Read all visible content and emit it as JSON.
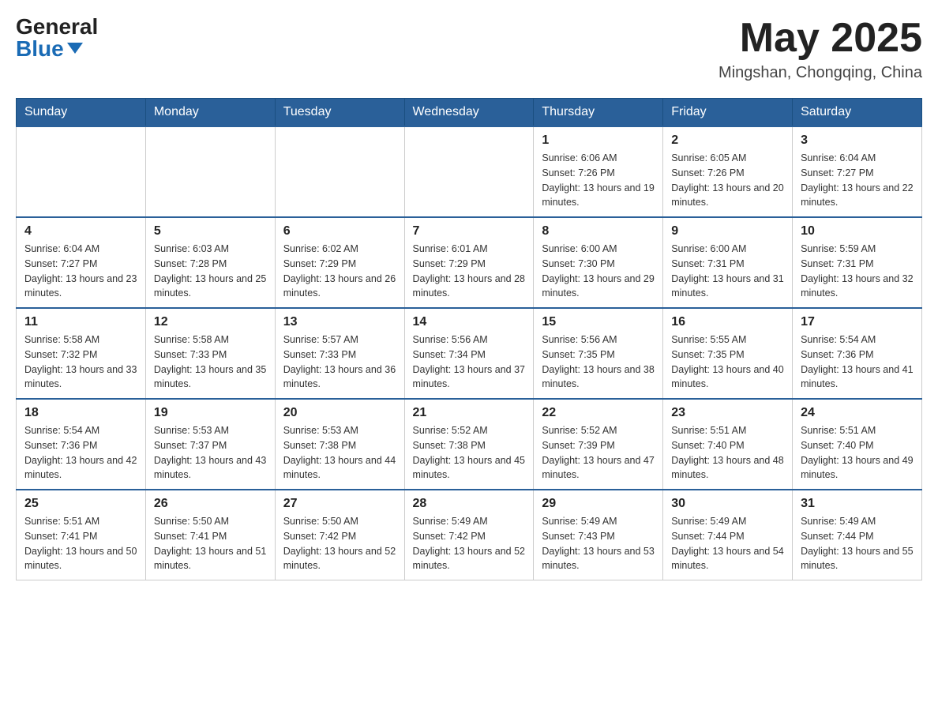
{
  "header": {
    "logo_general": "General",
    "logo_blue": "Blue",
    "month_title": "May 2025",
    "location": "Mingshan, Chongqing, China"
  },
  "days_of_week": [
    "Sunday",
    "Monday",
    "Tuesday",
    "Wednesday",
    "Thursday",
    "Friday",
    "Saturday"
  ],
  "weeks": [
    {
      "days": [
        {
          "number": "",
          "info": ""
        },
        {
          "number": "",
          "info": ""
        },
        {
          "number": "",
          "info": ""
        },
        {
          "number": "",
          "info": ""
        },
        {
          "number": "1",
          "info": "Sunrise: 6:06 AM\nSunset: 7:26 PM\nDaylight: 13 hours and 19 minutes."
        },
        {
          "number": "2",
          "info": "Sunrise: 6:05 AM\nSunset: 7:26 PM\nDaylight: 13 hours and 20 minutes."
        },
        {
          "number": "3",
          "info": "Sunrise: 6:04 AM\nSunset: 7:27 PM\nDaylight: 13 hours and 22 minutes."
        }
      ]
    },
    {
      "days": [
        {
          "number": "4",
          "info": "Sunrise: 6:04 AM\nSunset: 7:27 PM\nDaylight: 13 hours and 23 minutes."
        },
        {
          "number": "5",
          "info": "Sunrise: 6:03 AM\nSunset: 7:28 PM\nDaylight: 13 hours and 25 minutes."
        },
        {
          "number": "6",
          "info": "Sunrise: 6:02 AM\nSunset: 7:29 PM\nDaylight: 13 hours and 26 minutes."
        },
        {
          "number": "7",
          "info": "Sunrise: 6:01 AM\nSunset: 7:29 PM\nDaylight: 13 hours and 28 minutes."
        },
        {
          "number": "8",
          "info": "Sunrise: 6:00 AM\nSunset: 7:30 PM\nDaylight: 13 hours and 29 minutes."
        },
        {
          "number": "9",
          "info": "Sunrise: 6:00 AM\nSunset: 7:31 PM\nDaylight: 13 hours and 31 minutes."
        },
        {
          "number": "10",
          "info": "Sunrise: 5:59 AM\nSunset: 7:31 PM\nDaylight: 13 hours and 32 minutes."
        }
      ]
    },
    {
      "days": [
        {
          "number": "11",
          "info": "Sunrise: 5:58 AM\nSunset: 7:32 PM\nDaylight: 13 hours and 33 minutes."
        },
        {
          "number": "12",
          "info": "Sunrise: 5:58 AM\nSunset: 7:33 PM\nDaylight: 13 hours and 35 minutes."
        },
        {
          "number": "13",
          "info": "Sunrise: 5:57 AM\nSunset: 7:33 PM\nDaylight: 13 hours and 36 minutes."
        },
        {
          "number": "14",
          "info": "Sunrise: 5:56 AM\nSunset: 7:34 PM\nDaylight: 13 hours and 37 minutes."
        },
        {
          "number": "15",
          "info": "Sunrise: 5:56 AM\nSunset: 7:35 PM\nDaylight: 13 hours and 38 minutes."
        },
        {
          "number": "16",
          "info": "Sunrise: 5:55 AM\nSunset: 7:35 PM\nDaylight: 13 hours and 40 minutes."
        },
        {
          "number": "17",
          "info": "Sunrise: 5:54 AM\nSunset: 7:36 PM\nDaylight: 13 hours and 41 minutes."
        }
      ]
    },
    {
      "days": [
        {
          "number": "18",
          "info": "Sunrise: 5:54 AM\nSunset: 7:36 PM\nDaylight: 13 hours and 42 minutes."
        },
        {
          "number": "19",
          "info": "Sunrise: 5:53 AM\nSunset: 7:37 PM\nDaylight: 13 hours and 43 minutes."
        },
        {
          "number": "20",
          "info": "Sunrise: 5:53 AM\nSunset: 7:38 PM\nDaylight: 13 hours and 44 minutes."
        },
        {
          "number": "21",
          "info": "Sunrise: 5:52 AM\nSunset: 7:38 PM\nDaylight: 13 hours and 45 minutes."
        },
        {
          "number": "22",
          "info": "Sunrise: 5:52 AM\nSunset: 7:39 PM\nDaylight: 13 hours and 47 minutes."
        },
        {
          "number": "23",
          "info": "Sunrise: 5:51 AM\nSunset: 7:40 PM\nDaylight: 13 hours and 48 minutes."
        },
        {
          "number": "24",
          "info": "Sunrise: 5:51 AM\nSunset: 7:40 PM\nDaylight: 13 hours and 49 minutes."
        }
      ]
    },
    {
      "days": [
        {
          "number": "25",
          "info": "Sunrise: 5:51 AM\nSunset: 7:41 PM\nDaylight: 13 hours and 50 minutes."
        },
        {
          "number": "26",
          "info": "Sunrise: 5:50 AM\nSunset: 7:41 PM\nDaylight: 13 hours and 51 minutes."
        },
        {
          "number": "27",
          "info": "Sunrise: 5:50 AM\nSunset: 7:42 PM\nDaylight: 13 hours and 52 minutes."
        },
        {
          "number": "28",
          "info": "Sunrise: 5:49 AM\nSunset: 7:42 PM\nDaylight: 13 hours and 52 minutes."
        },
        {
          "number": "29",
          "info": "Sunrise: 5:49 AM\nSunset: 7:43 PM\nDaylight: 13 hours and 53 minutes."
        },
        {
          "number": "30",
          "info": "Sunrise: 5:49 AM\nSunset: 7:44 PM\nDaylight: 13 hours and 54 minutes."
        },
        {
          "number": "31",
          "info": "Sunrise: 5:49 AM\nSunset: 7:44 PM\nDaylight: 13 hours and 55 minutes."
        }
      ]
    }
  ]
}
